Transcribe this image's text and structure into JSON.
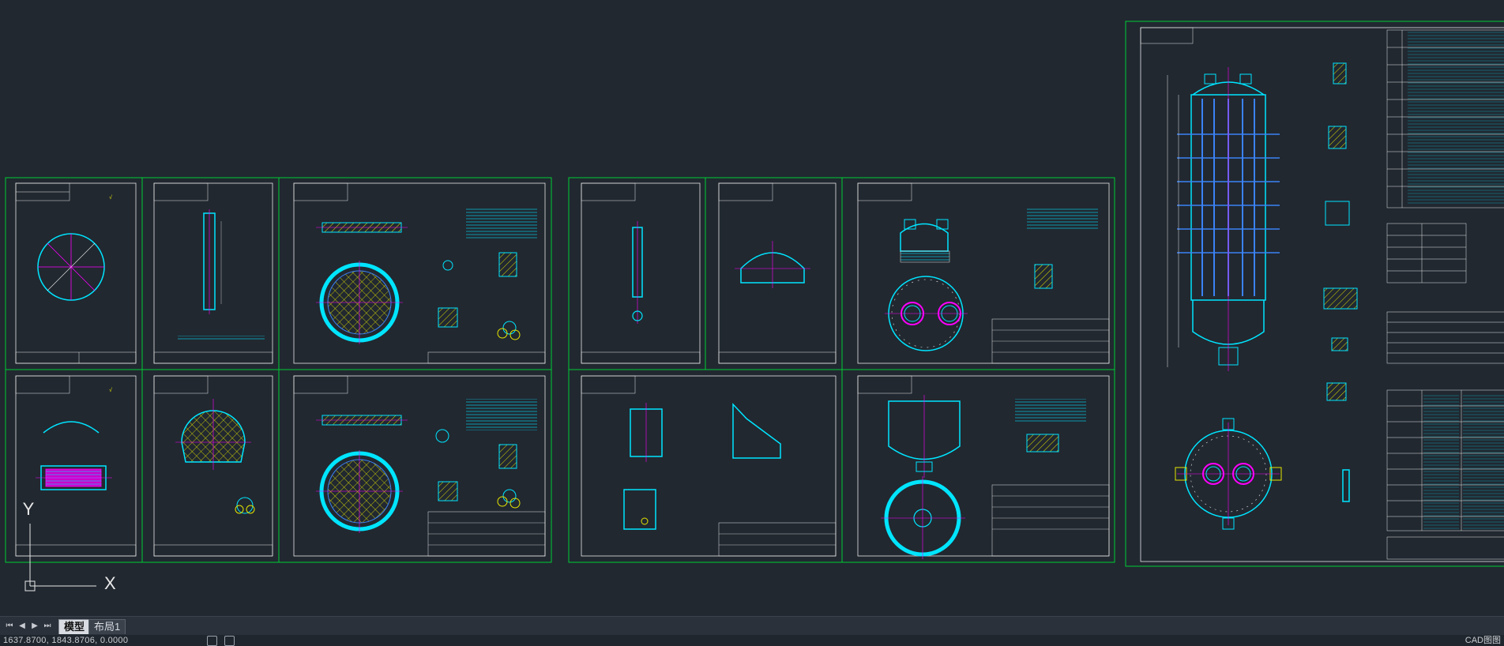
{
  "tabs": [
    {
      "label": "模型",
      "active": true
    },
    {
      "label": "布局1",
      "active": false
    }
  ],
  "nav_icons": [
    "first-page-icon",
    "prev-page-icon",
    "next-page-icon",
    "last-page-icon"
  ],
  "status": {
    "coordinates": "1637.8700, 1843.8706, 0.0000",
    "right_label": "CAD图图"
  },
  "ucs": {
    "x_label": "X",
    "y_label": "Y"
  },
  "colors": {
    "background": "#212830",
    "frame": "#00cc33",
    "cyan": "#00e5ff",
    "blue": "#3b82f6",
    "magenta": "#ff00ff",
    "yellow": "#e5e500",
    "white": "#e8e8e8"
  }
}
